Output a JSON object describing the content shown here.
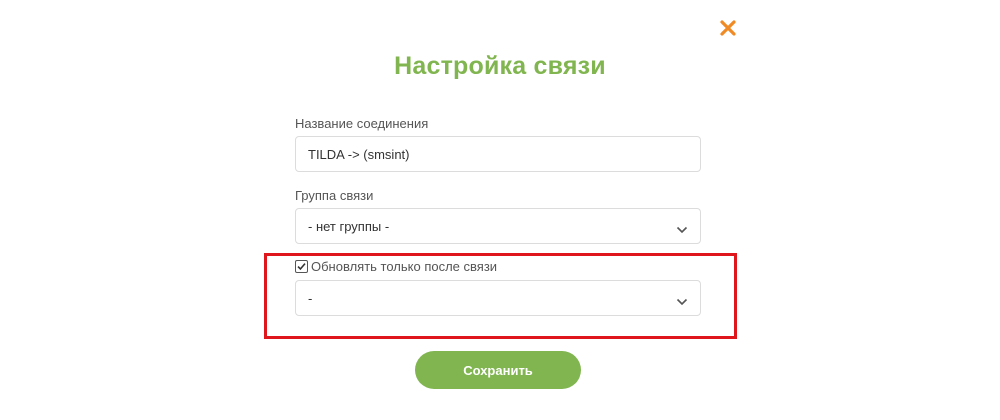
{
  "modal": {
    "title": "Настройка связи",
    "close_icon": "close-x-icon",
    "colors": {
      "accent_green": "#80b54f",
      "close_orange": "#ef8a25",
      "highlight_red": "#e0161d",
      "border_gray": "#dcdcdc"
    }
  },
  "connection_name": {
    "label": "Название соединения",
    "value": "TILDA -> (smsint)"
  },
  "connection_group": {
    "label": "Группа связи",
    "selected": "- нет группы -",
    "icon": "chevron-down-icon"
  },
  "update_after": {
    "checkbox_label": "Обновлять только после связи",
    "checked": true,
    "selected": "-",
    "icon": "chevron-down-icon"
  },
  "actions": {
    "save_label": "Сохранить"
  }
}
